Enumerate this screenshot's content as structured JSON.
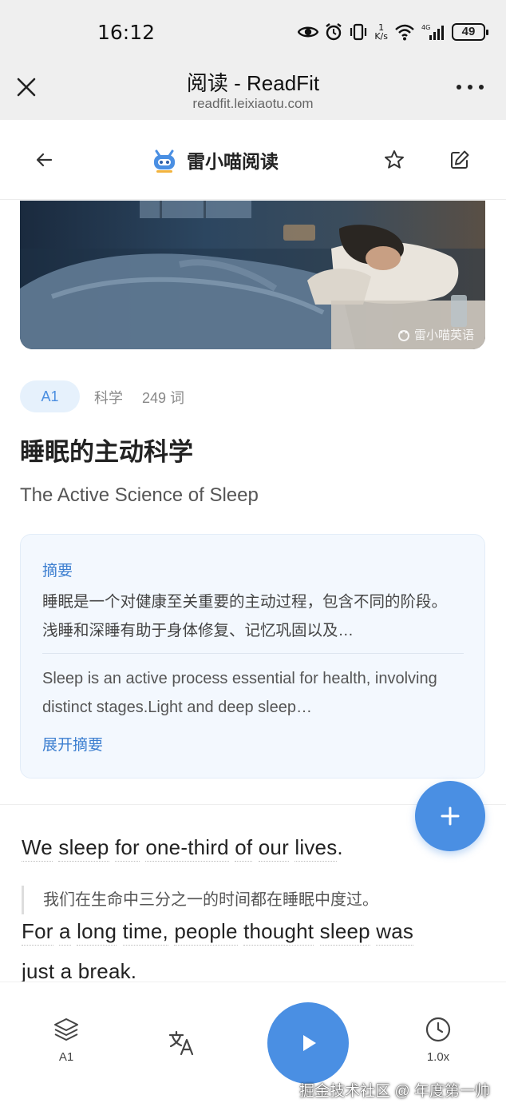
{
  "status_bar": {
    "time": "16:12",
    "net_speed_value": "1",
    "net_speed_unit": "K/s",
    "battery": "49"
  },
  "browser": {
    "title": "阅读 - ReadFit",
    "url": "readfit.leixiaotu.com"
  },
  "app_header": {
    "brand_name": "雷小喵阅读"
  },
  "hero": {
    "watermark": "雷小喵英语"
  },
  "article": {
    "level": "A1",
    "category": "科学",
    "word_count": "249 词",
    "title_zh": "睡眠的主动科学",
    "title_en": "The Active Science of Sleep"
  },
  "summary": {
    "label": "摘要",
    "text_zh": "睡眠是一个对健康至关重要的主动过程，包含不同的阶段。浅睡和深睡有助于身体修复、记忆巩固以及…",
    "text_en": "Sleep is an active process essential for health, involving distinct stages.Light and deep sleep…",
    "expand_label": "展开摘要"
  },
  "body": {
    "sentence1_words": [
      "We",
      "sleep",
      "for",
      "one-third",
      "of",
      "our",
      "lives"
    ],
    "sentence1_end": ".",
    "translation1": "我们在生命中三分之一的时间都在睡眠中度过。",
    "sentence2_words": [
      "For",
      "a",
      "long",
      "time,",
      "people",
      "thought",
      "sleep",
      "was"
    ],
    "sentence3_text": "just a break."
  },
  "bottom_bar": {
    "level_label": "A1",
    "speed_label": "1.0x"
  },
  "watermark": "掘金技术社区 @ 年度第一帅",
  "colors": {
    "accent": "#4a8fe3",
    "badge_bg": "#e6f1fc",
    "summary_bg": "#f3f8fe"
  },
  "icons": {
    "close": "close-icon",
    "more": "more-icon",
    "back": "arrow-left-icon",
    "logo": "cat-robot-logo",
    "star": "star-icon",
    "edit": "edit-icon",
    "plus": "plus-icon",
    "layers": "layers-icon",
    "translate": "translate-icon",
    "play": "play-icon",
    "clock": "clock-icon"
  }
}
